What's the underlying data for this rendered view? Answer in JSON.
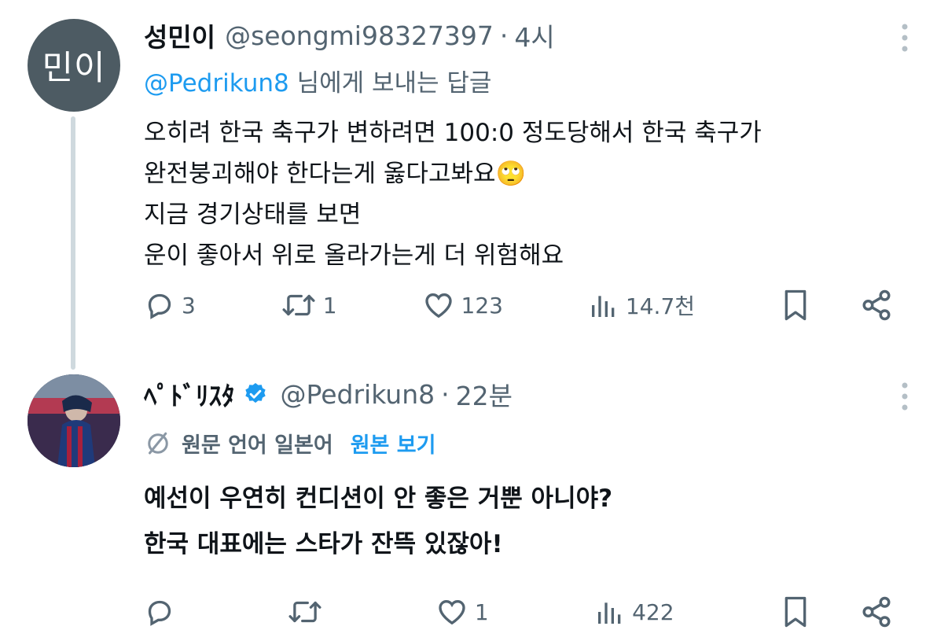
{
  "thread": [
    {
      "avatar_text": "민이",
      "display_name": "성민이",
      "handle": "@seongmi98327397",
      "separator": "·",
      "time": "4시",
      "reply_prefix_mention": "@Pedrikun8",
      "reply_suffix": " 님에게 보내는 답글",
      "body_lines": [
        "오히려 한국 축구가 변하려면 100:0 정도당해서 한국 축구가",
        "완전붕괴해야 한다는게 옳다고봐요🙄",
        "지금 경기상태를 보면",
        "운이 좋아서 위로 올라가는게 더 위험해요"
      ],
      "stats": {
        "replies": "3",
        "retweets": "1",
        "likes": "123",
        "views": "14.7천"
      }
    },
    {
      "display_name": "ﾍﾟﾄﾞﾘｽﾀ",
      "verified": true,
      "handle": "@Pedrikun8",
      "separator": "·",
      "time": "22분",
      "translated_label": "원문 언어 일본어",
      "show_original": "원본 보기",
      "body_lines": [
        "예선이 우연히 컨디션이 안 좋은 거뿐 아니야?",
        "한국 대표에는 스타가 잔뜩 있잖아!"
      ],
      "stats": {
        "replies": "",
        "retweets": "",
        "likes": "1",
        "views": "422"
      }
    }
  ],
  "icons": {
    "reply": "reply-icon",
    "retweet": "retweet-icon",
    "like": "heart-icon",
    "views": "views-icon",
    "bookmark": "bookmark-icon",
    "share": "share-icon",
    "more": "more-icon",
    "translate": "translate-icon",
    "verified": "verified-badge-icon"
  },
  "colors": {
    "link": "#1d9bf0",
    "muted": "#536471",
    "text": "#0f1419",
    "avatar_bg": "#4d5b63",
    "thread_line": "#cfd9de"
  }
}
